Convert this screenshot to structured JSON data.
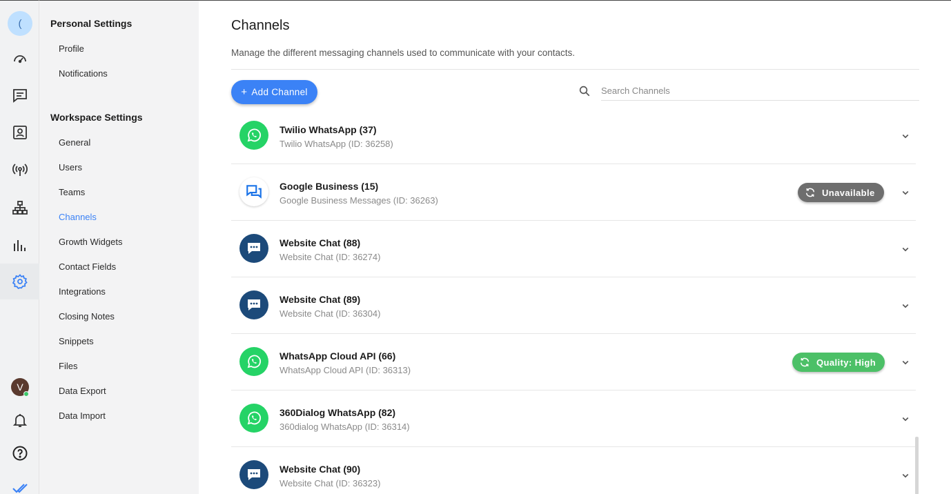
{
  "rail": {
    "top_glyph": "(",
    "avatar_initial": "V",
    "icons": [
      "dashboard-icon",
      "messages-icon",
      "contacts-icon",
      "broadcast-icon",
      "workflows-icon",
      "reports-icon",
      "settings-icon",
      "notifications-icon",
      "help-icon",
      "brand-checkmark-icon"
    ]
  },
  "sidebar": {
    "personal_heading": "Personal Settings",
    "personal_items": [
      {
        "label": "Profile"
      },
      {
        "label": "Notifications"
      }
    ],
    "workspace_heading": "Workspace Settings",
    "workspace_items": [
      {
        "label": "General"
      },
      {
        "label": "Users"
      },
      {
        "label": "Teams"
      },
      {
        "label": "Channels",
        "active": true
      },
      {
        "label": "Growth Widgets"
      },
      {
        "label": "Contact Fields"
      },
      {
        "label": "Integrations"
      },
      {
        "label": "Closing Notes"
      },
      {
        "label": "Snippets"
      },
      {
        "label": "Files"
      },
      {
        "label": "Data Export"
      },
      {
        "label": "Data Import"
      }
    ]
  },
  "main": {
    "title": "Channels",
    "description": "Manage the different messaging channels used to communicate with your contacts.",
    "add_button_label": "Add Channel",
    "add_button_plus": "+",
    "search_placeholder": "Search Channels",
    "channels": [
      {
        "name": "Twilio WhatsApp (37)",
        "sub": "Twilio WhatsApp (ID: 36258)",
        "icon": "whatsapp",
        "badge": null
      },
      {
        "name": "Google Business (15)",
        "sub": "Google Business Messages (ID: 36263)",
        "icon": "gbm",
        "badge": {
          "label": "Unavailable",
          "color": "#6e6e6e"
        }
      },
      {
        "name": "Website Chat (88)",
        "sub": "Website Chat (ID: 36274)",
        "icon": "webchat",
        "badge": null
      },
      {
        "name": "Website Chat (89)",
        "sub": "Website Chat (ID: 36304)",
        "icon": "webchat",
        "badge": null
      },
      {
        "name": "WhatsApp Cloud API (66)",
        "sub": "WhatsApp Cloud API (ID: 36313)",
        "icon": "whatsapp",
        "badge": {
          "label": "Quality: High",
          "color": "#4cc067"
        }
      },
      {
        "name": "360Dialog WhatsApp (82)",
        "sub": "360dialog WhatsApp (ID: 36314)",
        "icon": "whatsapp",
        "badge": null
      },
      {
        "name": "Website Chat (90)",
        "sub": "Website Chat (ID: 36323)",
        "icon": "webchat",
        "badge": null
      }
    ]
  },
  "colors": {
    "accent": "#3b82f6",
    "whatsapp": "#25d366",
    "webchat": "#1c4a7a"
  }
}
